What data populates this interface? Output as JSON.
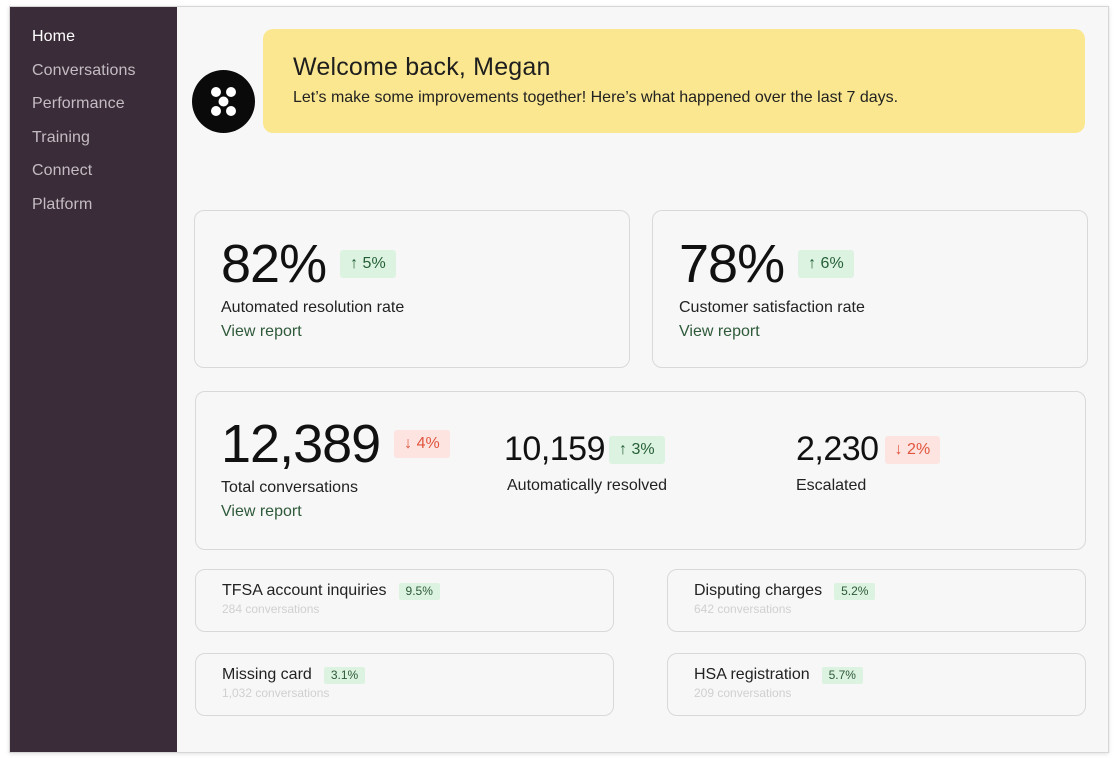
{
  "sidebar": {
    "items": [
      {
        "label": "Home"
      },
      {
        "label": "Conversations"
      },
      {
        "label": "Performance"
      },
      {
        "label": "Training"
      },
      {
        "label": "Connect"
      },
      {
        "label": "Platform"
      }
    ]
  },
  "welcome": {
    "title": "Welcome back, Megan",
    "subtitle": "Let’s make some improvements together! Here’s what happened over the last 7 days."
  },
  "metrics": {
    "automated": {
      "value": "82%",
      "change": "↑ 5%",
      "label": "Automated resolution rate",
      "link": "View report"
    },
    "csat": {
      "value": "78%",
      "change": "↑ 6%",
      "label": "Customer satisfaction rate",
      "link": "View report"
    }
  },
  "volume": {
    "total": {
      "value": "12,389",
      "change": "↓ 4%",
      "label": "Total conversations",
      "link": "View report"
    },
    "resolved": {
      "value": "10,159",
      "change": "↑ 3%",
      "label": "Automatically resolved"
    },
    "escalated": {
      "value": "2,230",
      "change": "↓ 2%",
      "label": "Escalated"
    }
  },
  "topics": [
    {
      "title": "TFSA account inquiries",
      "pct": "9.5%",
      "count": "284 conversations"
    },
    {
      "title": "Disputing charges",
      "pct": "5.2%",
      "count": "642 conversations"
    },
    {
      "title": "Missing card",
      "pct": "3.1%",
      "count": "1,032 conversations"
    },
    {
      "title": "HSA registration",
      "pct": "5.7%",
      "count": "209 conversations"
    }
  ],
  "colors": {
    "sidebar_bg": "#3a2c39",
    "banner_bg": "#fbe78f",
    "positive_bg": "#ddf3e1",
    "negative_bg": "#fde4e0",
    "negative_text": "#e1553e"
  },
  "icons": {
    "avatar": "dots-logo-icon"
  }
}
